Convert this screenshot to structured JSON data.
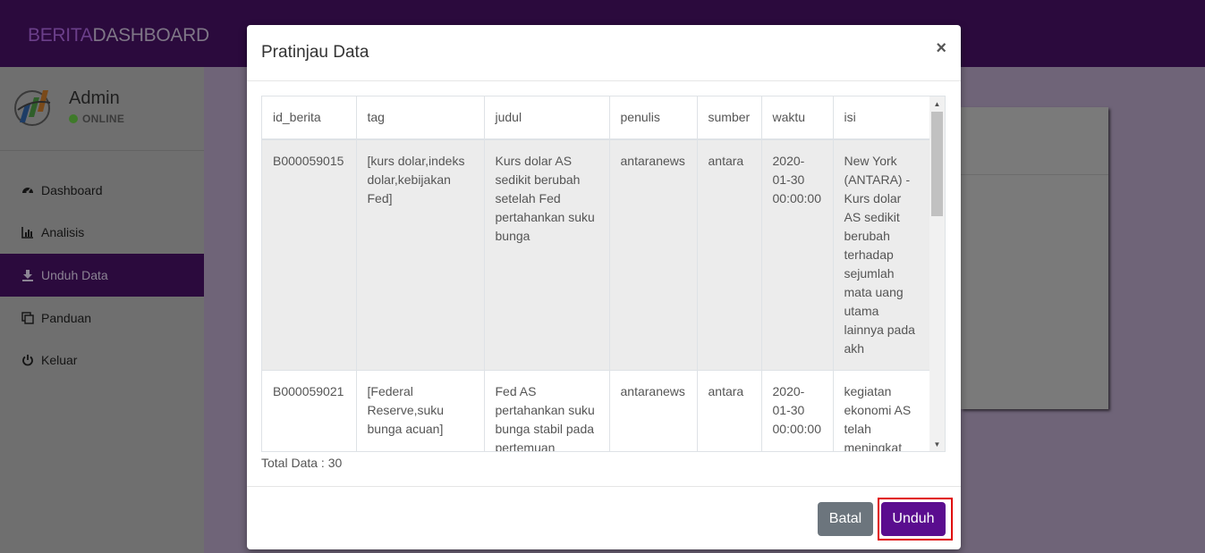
{
  "brand": {
    "part1": "BERITA",
    "part2": "DASHBOARD"
  },
  "user": {
    "name": "Admin",
    "status": "ONLINE"
  },
  "sidebar": {
    "items": [
      {
        "label": "Dashboard",
        "icon": "dashboard-icon",
        "active": false
      },
      {
        "label": "Analisis",
        "icon": "bar-chart-icon",
        "active": false
      },
      {
        "label": "Unduh Data",
        "icon": "download-icon",
        "active": true
      },
      {
        "label": "Panduan",
        "icon": "copy-icon",
        "active": false
      },
      {
        "label": "Keluar",
        "icon": "power-icon",
        "active": false
      }
    ]
  },
  "modal": {
    "title": "Pratinjau Data",
    "close": "×",
    "columns": [
      "id_berita",
      "tag",
      "judul",
      "penulis",
      "sumber",
      "waktu",
      "isi"
    ],
    "rows": [
      {
        "id_berita": "B000059015",
        "tag": "[kurs dolar,indeks dolar,kebijakan Fed]",
        "judul": "Kurs dolar AS sedikit berubah setelah Fed pertahankan suku bunga",
        "penulis": "antaranews",
        "sumber": "antara",
        "waktu": "2020-01-30 00:00:00",
        "isi": "New York (ANTARA) - Kurs dolar AS sedikit berubah terhadap sejumlah mata uang utama lainnya pada akh"
      },
      {
        "id_berita": "B000059021",
        "tag": "[Federal Reserve,suku bunga acuan]",
        "judul": "Fed AS pertahankan suku bunga stabil pada pertemuan",
        "penulis": "antaranews",
        "sumber": "antara",
        "waktu": "2020-01-30 00:00:00",
        "isi": "kegiatan ekonomi AS telah meningkat"
      }
    ],
    "total_label": "Total Data : 30",
    "buttons": {
      "cancel": "Batal",
      "download": "Unduh"
    }
  },
  "colors": {
    "brand_purple": "#5a0d8f",
    "topbar": "#2b0a3d",
    "cancel_gray": "#6c757d",
    "highlight_red": "#e00000",
    "online_green": "#3f7a2a"
  }
}
